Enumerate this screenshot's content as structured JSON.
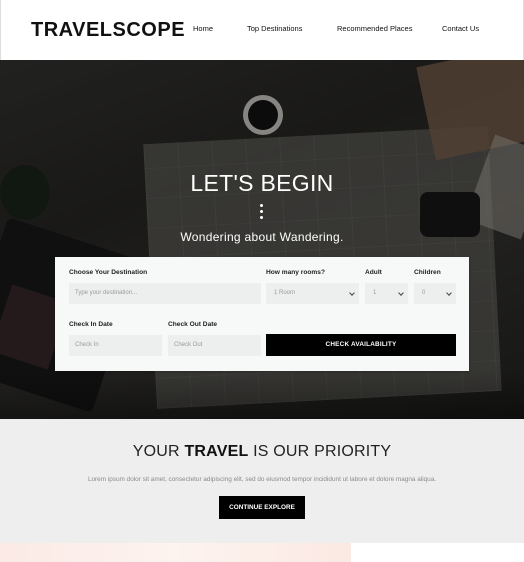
{
  "header": {
    "logo": "TRAVELSCOPE",
    "nav": [
      "Home",
      "Top Destinations",
      "Recommended Places",
      "Contact Us"
    ]
  },
  "hero": {
    "title": "LET'S BEGIN",
    "subtitle": "Wondering about Wandering."
  },
  "booking": {
    "destination_label": "Choose Your Destination",
    "destination_placeholder": "Type your destination...",
    "rooms_label": "How many rooms?",
    "rooms_value": "1 Room",
    "adult_label": "Adult",
    "adult_value": "1",
    "children_label": "Children",
    "children_value": "0",
    "checkin_label": "Check In Date",
    "checkin_placeholder": "Check In",
    "checkout_label": "Check Out Date",
    "checkout_placeholder": "Check Out",
    "submit_label": "CHECK AVAILABILITY"
  },
  "priority": {
    "title_pre": "YOUR",
    "title_bold": "TRAVEL",
    "title_post": "IS OUR PRIORITY",
    "text": "Lorem ipsum dolor sit amet, consectetur adipiscing elit, sed do eiusmod tempor incididunt ut labore et dolore magna aliqua.",
    "button_label": "CONTINUE EXPLORE"
  },
  "colors": {
    "accent": "#000000",
    "section_bg": "#eeeeee",
    "form_bg": "#f7f8f8"
  }
}
